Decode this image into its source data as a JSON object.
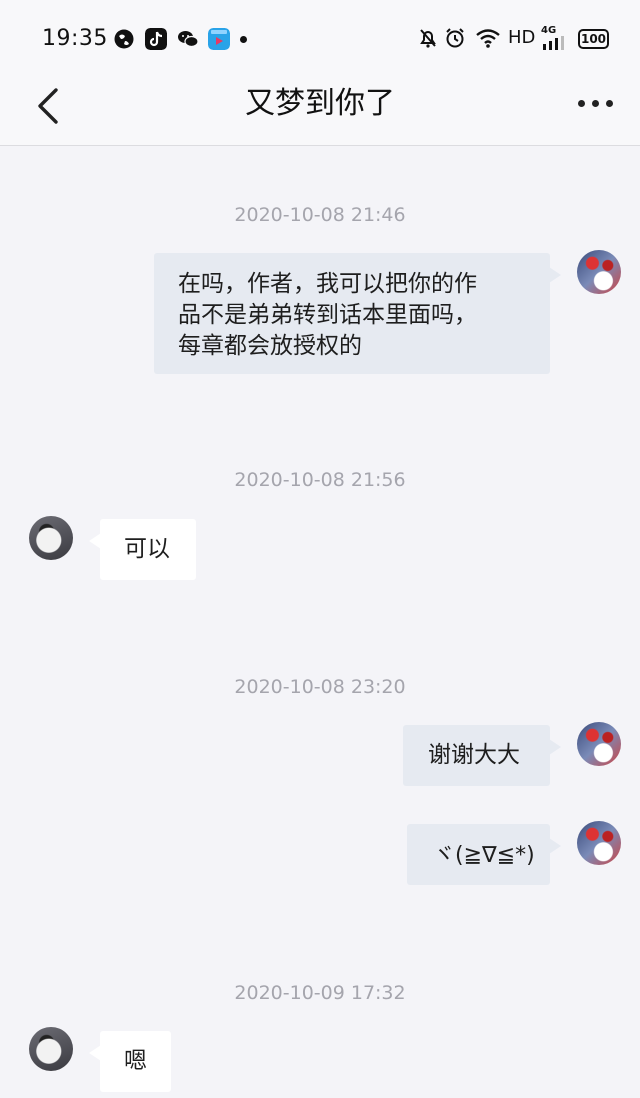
{
  "status_bar": {
    "time": "19:35",
    "app_icons": [
      "globe-icon",
      "tiktok-icon",
      "wechat-icon",
      "video-app-icon"
    ],
    "right_icons": [
      "mute-bell-icon",
      "alarm-icon",
      "wifi-icon"
    ],
    "hd": "HD",
    "network": "4G",
    "battery": "100"
  },
  "nav": {
    "title": "又梦到你了"
  },
  "chat": [
    {
      "type": "timestamp",
      "text": "2020-10-08 21:46"
    },
    {
      "type": "message",
      "side": "out",
      "lines": [
        "在吗，作者，我可以把你的作",
        "品不是弟弟转到话本里面吗，",
        "每章都会放授权的"
      ]
    },
    {
      "type": "timestamp",
      "text": "2020-10-08 21:56"
    },
    {
      "type": "message",
      "side": "in",
      "text": "可以"
    },
    {
      "type": "timestamp",
      "text": "2020-10-08 23:20"
    },
    {
      "type": "message",
      "side": "out",
      "text": "谢谢大大"
    },
    {
      "type": "message",
      "side": "out",
      "text": "ヾ(≧∇≦*)"
    },
    {
      "type": "timestamp",
      "text": "2020-10-09 17:32"
    },
    {
      "type": "message",
      "side": "in",
      "text": "嗯"
    }
  ],
  "colors": {
    "background": "#f4f4f8",
    "outgoing_bubble": "#e6eaf1",
    "incoming_bubble": "#ffffff",
    "timestamp": "#a5a5ad"
  }
}
